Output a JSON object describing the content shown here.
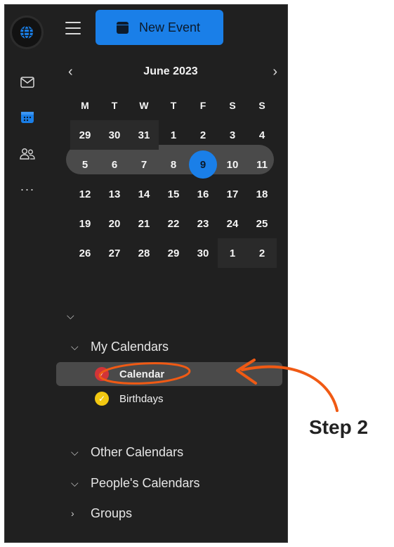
{
  "header": {
    "new_event_label": "New Event"
  },
  "rail": {
    "icons": [
      "globe-icon",
      "mail-icon",
      "calendar-icon",
      "people-icon",
      "more-icon"
    ],
    "more_glyph": "···"
  },
  "mini_calendar": {
    "month_title": "June 2023",
    "prev_glyph": "‹",
    "next_glyph": "›",
    "weekdays": [
      "M",
      "T",
      "W",
      "T",
      "F",
      "S",
      "S"
    ],
    "weeks": [
      [
        "29",
        "30",
        "31",
        "1",
        "2",
        "3",
        "4"
      ],
      [
        "5",
        "6",
        "7",
        "8",
        "9",
        "10",
        "11"
      ],
      [
        "12",
        "13",
        "14",
        "15",
        "16",
        "17",
        "18"
      ],
      [
        "19",
        "20",
        "21",
        "22",
        "23",
        "24",
        "25"
      ],
      [
        "26",
        "27",
        "28",
        "29",
        "30",
        "1",
        "2"
      ]
    ],
    "today": "9",
    "accent_color": "#1a7fe8"
  },
  "folders": {
    "my_calendars": {
      "label": "My Calendars",
      "items": [
        {
          "label": "Calendar",
          "color": "#d13438",
          "selected": true
        },
        {
          "label": "Birthdays",
          "color": "#f2c811",
          "selected": false
        }
      ]
    },
    "other_calendars": {
      "label": "Other Calendars"
    },
    "peoples_calendars": {
      "label": "People's Calendars"
    },
    "groups": {
      "label": "Groups"
    }
  },
  "annotation": {
    "label": "Step 2",
    "color": "#f05a14"
  }
}
